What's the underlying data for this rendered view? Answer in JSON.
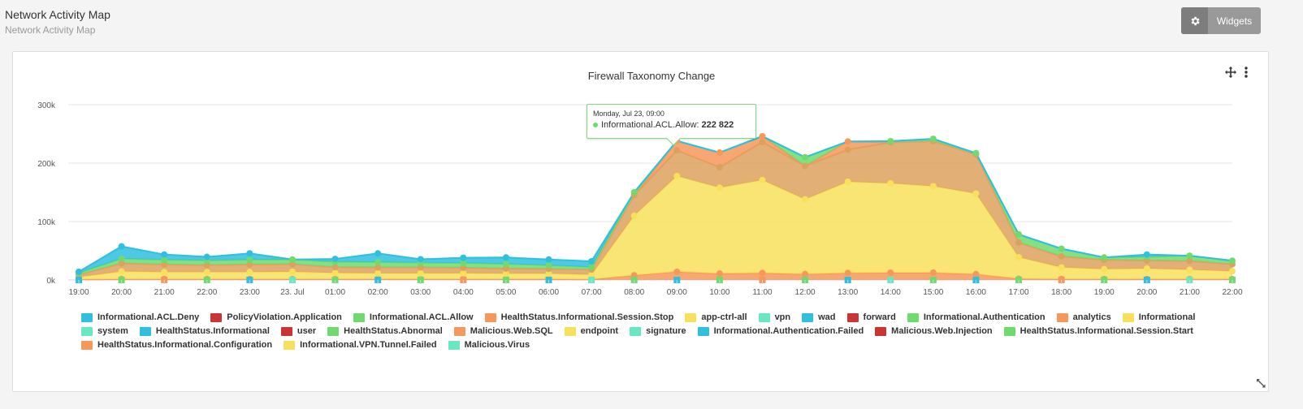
{
  "header": {
    "title": "Network Activity Map",
    "subtitle": "Network Activity Map"
  },
  "toolbar": {
    "widgets_label": "Widgets"
  },
  "tooltip": {
    "date": "Monday, Jul 23, 09:00",
    "series": "Informational.ACL.Allow",
    "value": "222 822",
    "color": "#6ddc6d"
  },
  "chart_data": {
    "type": "area",
    "stacked": true,
    "title": "Firewall Taxonomy Change",
    "xlabel": "",
    "ylabel": "",
    "ylim": [
      0,
      300000
    ],
    "y_ticks": [
      "0k",
      "100k",
      "200k",
      "300k"
    ],
    "y_tick_values": [
      0,
      100000,
      200000,
      300000
    ],
    "grid": true,
    "legend_position": "bottom",
    "x": [
      "19:00",
      "20:00",
      "21:00",
      "22:00",
      "23:00",
      "23. Jul",
      "01:00",
      "02:00",
      "03:00",
      "04:00",
      "05:00",
      "06:00",
      "07:00",
      "08:00",
      "09:00",
      "10:00",
      "11:00",
      "12:00",
      "13:00",
      "14:00",
      "15:00",
      "16:00",
      "17:00",
      "18:00",
      "19:00",
      "20:00",
      "21:00",
      "22:00"
    ],
    "series": [
      {
        "name": "HealthStatus.Informational.Session.Stop",
        "color": "#f7985a",
        "values": [
          1000,
          1500,
          1500,
          1500,
          1500,
          1500,
          1500,
          1500,
          1500,
          1500,
          1500,
          1500,
          1000,
          8000,
          14000,
          11000,
          12000,
          10000,
          12000,
          12500,
          12500,
          10000,
          2000,
          1500,
          1500,
          1500,
          1500,
          1500
        ]
      },
      {
        "name": "app-ctrl-all",
        "color": "#f8e05a",
        "values": [
          4000,
          13000,
          12000,
          12000,
          12000,
          12500,
          10500,
          10000,
          10000,
          10000,
          9500,
          9500,
          8000,
          102000,
          164000,
          147000,
          159000,
          128000,
          156000,
          153000,
          148000,
          138000,
          37000,
          20000,
          17000,
          18000,
          16000,
          13500
        ]
      },
      {
        "name": "analytics",
        "color": "#dda15e",
        "values": [
          4000,
          14000,
          13000,
          12000,
          13000,
          13000,
          10000,
          10000,
          10000,
          9500,
          8500,
          8000,
          9000,
          35000,
          44000,
          35000,
          65000,
          57000,
          55000,
          70000,
          77000,
          67000,
          25000,
          19000,
          16000,
          14000,
          15000,
          12000
        ]
      },
      {
        "name": "Informational.ACL.Allow",
        "color": "#f7985a",
        "values": [
          0,
          0,
          0,
          0,
          0,
          0,
          0,
          0,
          0,
          0,
          0,
          0,
          0,
          0,
          16000,
          25000,
          10000,
          0,
          14000,
          0,
          0,
          0,
          0,
          0,
          0,
          0,
          0,
          0
        ]
      },
      {
        "name": "Informational.Authentication",
        "color": "#6ddc6d",
        "values": [
          3000,
          8000,
          8000,
          8000,
          8000,
          8000,
          9000,
          9000,
          8000,
          8000,
          8000,
          6000,
          4000,
          5000,
          0,
          0,
          0,
          15000,
          0,
          2000,
          4000,
          2000,
          14000,
          13000,
          4000,
          6000,
          9000,
          6000
        ]
      },
      {
        "name": "Informational.ACL.Deny",
        "color": "#2fbfe0",
        "values": [
          2000,
          21000,
          9000,
          6000,
          11000,
          0,
          5000,
          15000,
          6000,
          9000,
          11000,
          10000,
          10000,
          0,
          0,
          0,
          0,
          0,
          0,
          0,
          0,
          0,
          0,
          0,
          0,
          4000,
          0,
          0
        ]
      },
      {
        "name": "PolicyViolation.Application",
        "color": "#cc3333",
        "values": [
          0,
          0,
          0,
          0,
          0,
          0,
          0,
          0,
          0,
          0,
          0,
          0,
          0,
          0,
          0,
          0,
          0,
          0,
          0,
          0,
          0,
          0,
          0,
          0,
          0,
          0,
          0,
          0
        ]
      }
    ],
    "legend": [
      {
        "name": "Informational.ACL.Deny",
        "color": "#2fbfe0"
      },
      {
        "name": "PolicyViolation.Application",
        "color": "#cc3333"
      },
      {
        "name": "Informational.ACL.Allow",
        "color": "#6ddc6d"
      },
      {
        "name": "HealthStatus.Informational.Session.Stop",
        "color": "#f7985a"
      },
      {
        "name": "app-ctrl-all",
        "color": "#f8e05a"
      },
      {
        "name": "vpn",
        "color": "#66e8c0"
      },
      {
        "name": "wad",
        "color": "#2fbfe0"
      },
      {
        "name": "forward",
        "color": "#cc3333"
      },
      {
        "name": "Informational.Authentication",
        "color": "#6ddc6d"
      },
      {
        "name": "analytics",
        "color": "#f7985a"
      },
      {
        "name": "Informational",
        "color": "#f8e05a"
      },
      {
        "name": "system",
        "color": "#66e8c0"
      },
      {
        "name": "HealthStatus.Informational",
        "color": "#2fbfe0"
      },
      {
        "name": "user",
        "color": "#cc3333"
      },
      {
        "name": "HealthStatus.Abnormal",
        "color": "#6ddc6d"
      },
      {
        "name": "Malicious.Web.SQL",
        "color": "#f7985a"
      },
      {
        "name": "endpoint",
        "color": "#f8e05a"
      },
      {
        "name": "signature",
        "color": "#66e8c0"
      },
      {
        "name": "Informational.Authentication.Failed",
        "color": "#2fbfe0"
      },
      {
        "name": "Malicious.Web.Injection",
        "color": "#cc3333"
      },
      {
        "name": "HealthStatus.Informational.Session.Start",
        "color": "#6ddc6d"
      },
      {
        "name": "HealthStatus.Informational.Configuration",
        "color": "#f7985a"
      },
      {
        "name": "Informational.VPN.Tunnel.Failed",
        "color": "#f8e05a"
      },
      {
        "name": "Malicious.Virus",
        "color": "#66e8c0"
      }
    ]
  }
}
